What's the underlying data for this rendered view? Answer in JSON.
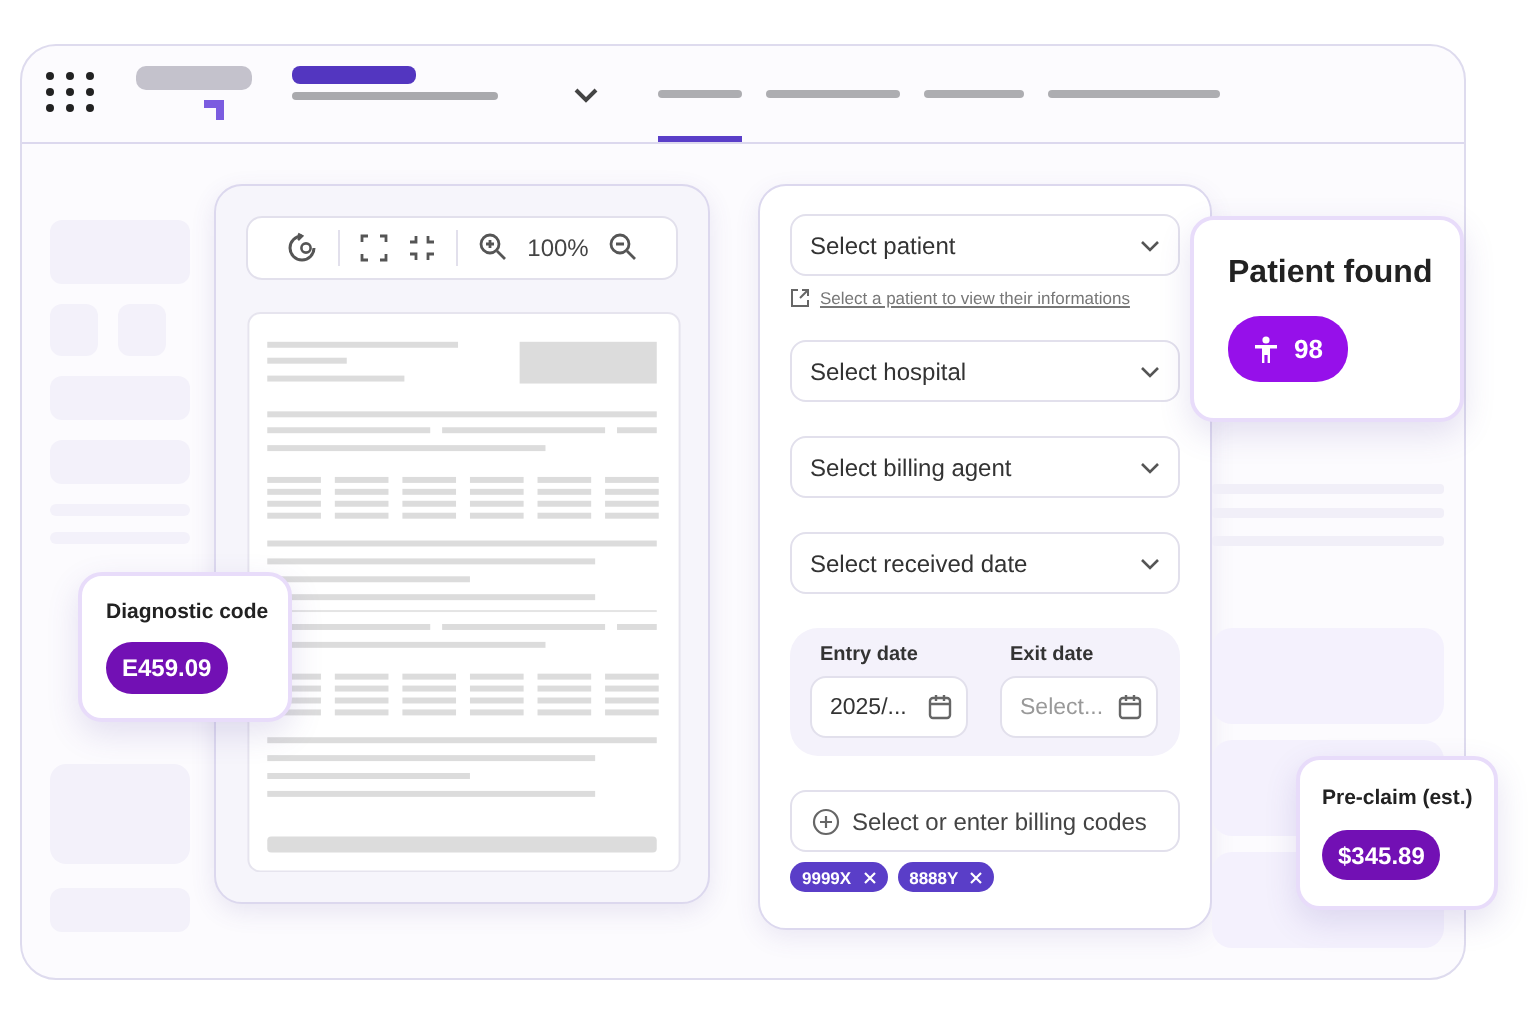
{
  "nav_tabs": [
    {
      "selected": true
    },
    {
      "selected": false
    },
    {
      "selected": false
    },
    {
      "selected": false
    }
  ],
  "viewer": {
    "zoom": "100%"
  },
  "form": {
    "patient_select": "Select patient",
    "patient_hint": "Select a patient to view their informations",
    "selects": [
      "Select hospital",
      "Select billing agent",
      "Select received date"
    ],
    "entry_date": {
      "label": "Entry date",
      "value": "2025/..."
    },
    "exit_date": {
      "label": "Exit date",
      "placeholder": "Select..."
    },
    "billing_codes": {
      "placeholder": "Select or enter billing codes",
      "tags": [
        "9999X",
        "8888Y"
      ]
    }
  },
  "patient_found": {
    "title": "Patient found",
    "count": "98"
  },
  "diagnostic": {
    "title": "Diagnostic code",
    "value": "E459.09"
  },
  "pre_claim": {
    "title": "Pre-claim (est.)",
    "value": "$345.89"
  }
}
